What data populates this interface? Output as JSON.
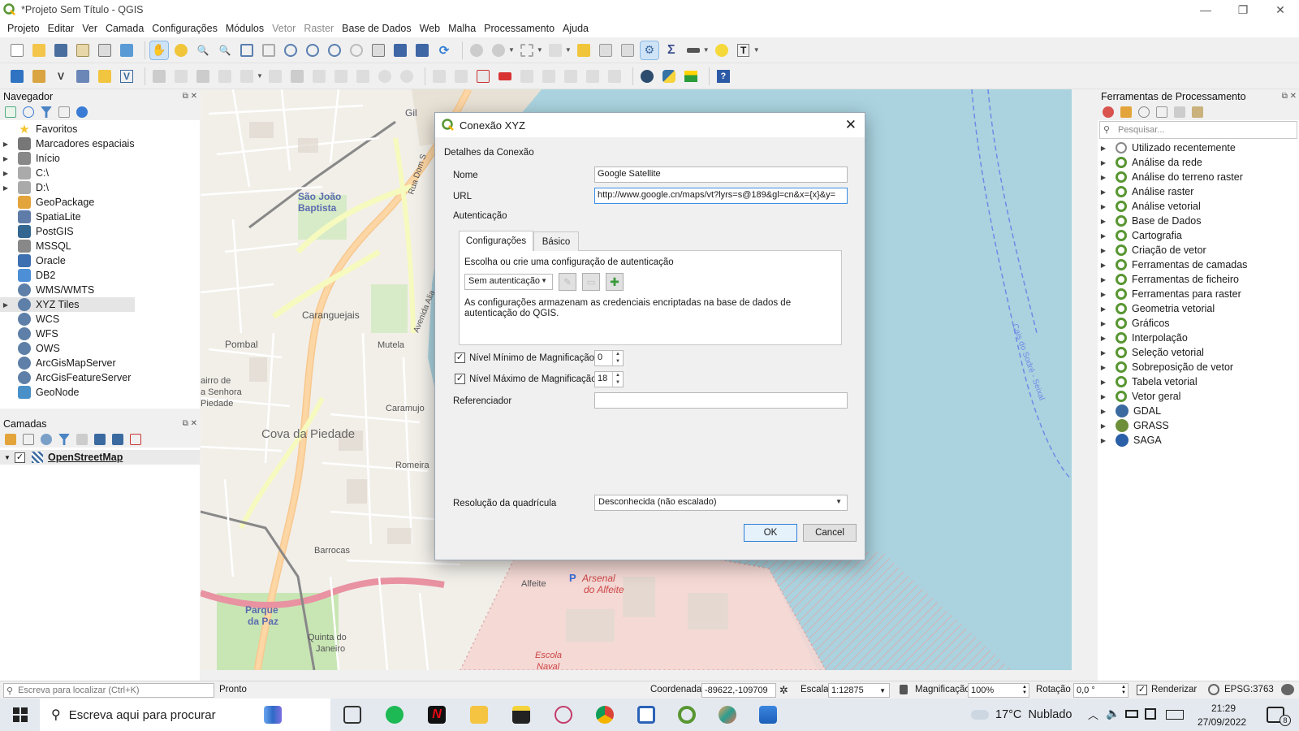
{
  "window": {
    "title": "*Projeto Sem Título - QGIS",
    "minimize_icon": "minimize-icon",
    "maximize_icon": "restore-icon",
    "close_icon": "close-icon"
  },
  "menubar": [
    "Projeto",
    "Editar",
    "Ver",
    "Camada",
    "Configurações",
    "Módulos",
    "Vetor",
    "Raster",
    "Base de Dados",
    "Web",
    "Malha",
    "Processamento",
    "Ajuda"
  ],
  "navigator": {
    "title": "Navegador",
    "items": [
      {
        "label": "Favoritos",
        "icon": "star-icon",
        "color": "#f4c430",
        "expand": false
      },
      {
        "label": "Marcadores espaciais",
        "icon": "bookmark-icon",
        "color": "#777777",
        "expand": true
      },
      {
        "label": "Início",
        "icon": "home-folder-icon",
        "color": "#888888",
        "expand": true
      },
      {
        "label": "C:\\",
        "icon": "folder-icon",
        "color": "#aaaaaa",
        "expand": true
      },
      {
        "label": "D:\\",
        "icon": "folder-icon",
        "color": "#aaaaaa",
        "expand": true
      },
      {
        "label": "GeoPackage",
        "icon": "geopackage-icon",
        "color": "#e3a43b",
        "expand": false
      },
      {
        "label": "SpatiaLite",
        "icon": "spatialite-icon",
        "color": "#5f7ba8",
        "expand": false
      },
      {
        "label": "PostGIS",
        "icon": "postgis-icon",
        "color": "#336791",
        "expand": false
      },
      {
        "label": "MSSQL",
        "icon": "mssql-icon",
        "color": "#888888",
        "expand": false
      },
      {
        "label": "Oracle",
        "icon": "oracle-icon",
        "color": "#3e6fb0",
        "expand": false
      },
      {
        "label": "DB2",
        "icon": "db2-icon",
        "color": "#4c8fd6",
        "expand": false
      },
      {
        "label": "WMS/WMTS",
        "icon": "globe-icon",
        "color": "#5e7fa8",
        "expand": false
      },
      {
        "label": "XYZ Tiles",
        "icon": "globe-icon",
        "color": "#5e7fa8",
        "expand": true
      },
      {
        "label": "WCS",
        "icon": "globe-icon",
        "color": "#5e7fa8",
        "expand": false
      },
      {
        "label": "WFS",
        "icon": "wfs-icon",
        "color": "#5e7fa8",
        "expand": false
      },
      {
        "label": "OWS",
        "icon": "globe-icon",
        "color": "#5e7fa8",
        "expand": false
      },
      {
        "label": "ArcGisMapServer",
        "icon": "arcgis-icon",
        "color": "#5e7fa8",
        "expand": false
      },
      {
        "label": "ArcGisFeatureServer",
        "icon": "arcgis-icon",
        "color": "#5e7fa8",
        "expand": false
      },
      {
        "label": "GeoNode",
        "icon": "geonode-icon",
        "color": "#4a90c8",
        "expand": false
      }
    ]
  },
  "layers": {
    "title": "Camadas",
    "items": [
      {
        "label": "OpenStreetMap",
        "checked": "✓"
      }
    ]
  },
  "processing": {
    "title": "Ferramentas de Processamento",
    "search_placeholder": "Pesquisar...",
    "items": [
      {
        "label": "Utilizado recentemente",
        "icon": "clock-icon",
        "color": "#888888"
      },
      {
        "label": "Análise da rede",
        "icon": "qgis-icon",
        "color": "#589632"
      },
      {
        "label": "Análise do terreno raster",
        "icon": "qgis-icon",
        "color": "#589632"
      },
      {
        "label": "Análise raster",
        "icon": "qgis-icon",
        "color": "#589632"
      },
      {
        "label": "Análise vetorial",
        "icon": "qgis-icon",
        "color": "#589632"
      },
      {
        "label": "Base de Dados",
        "icon": "qgis-icon",
        "color": "#589632"
      },
      {
        "label": "Cartografia",
        "icon": "qgis-icon",
        "color": "#589632"
      },
      {
        "label": "Criação de vetor",
        "icon": "qgis-icon",
        "color": "#589632"
      },
      {
        "label": "Ferramentas de camadas",
        "icon": "qgis-icon",
        "color": "#589632"
      },
      {
        "label": "Ferramentas de ficheiro",
        "icon": "qgis-icon",
        "color": "#589632"
      },
      {
        "label": "Ferramentas para raster",
        "icon": "qgis-icon",
        "color": "#589632"
      },
      {
        "label": "Geometria vetorial",
        "icon": "qgis-icon",
        "color": "#589632"
      },
      {
        "label": "Gráficos",
        "icon": "qgis-icon",
        "color": "#589632"
      },
      {
        "label": "Interpolação",
        "icon": "qgis-icon",
        "color": "#589632"
      },
      {
        "label": "Seleção vetorial",
        "icon": "qgis-icon",
        "color": "#589632"
      },
      {
        "label": "Sobreposição de vetor",
        "icon": "qgis-icon",
        "color": "#589632"
      },
      {
        "label": "Tabela vetorial",
        "icon": "qgis-icon",
        "color": "#589632"
      },
      {
        "label": "Vetor geral",
        "icon": "qgis-icon",
        "color": "#589632"
      },
      {
        "label": "GDAL",
        "icon": "gdal-icon",
        "color": "#3b6aa0"
      },
      {
        "label": "GRASS",
        "icon": "grass-icon",
        "color": "#6d8f3a"
      },
      {
        "label": "SAGA",
        "icon": "saga-icon",
        "color": "#2b5fa8"
      }
    ]
  },
  "map": {
    "labels": [
      "Gil",
      "São João Baptista",
      "Rua Dom S",
      "Caranguejais",
      "Pombal",
      "Avenida Alia",
      "Mutela",
      "airro de a Senhora Piedade",
      "Caramujo",
      "Cova da Piedade",
      "Romeira",
      "Barrocas",
      "Parque da Paz",
      "Quinta do Janeiro",
      "Alfeite",
      "Arsenal do Alfeite",
      "Escola Naval",
      "Cais do Sodré - Seixal"
    ]
  },
  "dialog": {
    "title": "Conexão XYZ",
    "section": "Detalhes da Conexão",
    "name_label": "Nome",
    "name_value": "Google Satellite",
    "url_label": "URL",
    "url_value": "http://www.google.cn/maps/vt?lyrs=s@189&gl=cn&x={x}&y=",
    "auth_label": "Autenticação",
    "tabs": [
      "Configurações",
      "Básico"
    ],
    "auth_hint": "Escolha ou crie uma configuração de autenticação",
    "auth_select": "Sem autenticação",
    "auth_note": "As configurações armazenam as credenciais encriptadas na base de dados de autenticação do QGIS.",
    "min_zoom_label": "Nível Mínimo de Magnificação",
    "min_zoom_value": "0",
    "min_zoom_checked": "✓",
    "max_zoom_label": "Nível Máximo de Magnificação",
    "max_zoom_value": "18",
    "max_zoom_checked": "✓",
    "referer_label": "Referenciador",
    "referer_value": "",
    "resolution_label": "Resolução da quadrícula",
    "resolution_value": "Desconhecida (não escalado)",
    "ok_label": "OK",
    "cancel_label": "Cancel"
  },
  "statusbar": {
    "locator_placeholder": "Escreva para localizar (Ctrl+K)",
    "status": "Pronto",
    "coord_label": "Coordenada",
    "coord_value": "-89622,-109709",
    "scale_label": "Escala",
    "scale_value": "1:12875",
    "magnifier_label": "Magnificação",
    "magnifier_value": "100%",
    "rotation_label": "Rotação",
    "rotation_value": "0,0 °",
    "render_label": "Renderizar",
    "render_checked": "✓",
    "crs": "EPSG:3763"
  },
  "taskbar": {
    "search_placeholder": "Escreva aqui para procurar",
    "weather": "17°C  Nublado",
    "time": "21:29",
    "date": "27/09/2022",
    "notifications": "8"
  },
  "colors": {
    "water": "#aad3df",
    "land": "#f2efe9",
    "qgis_green": "#589632",
    "accent": "#2f7fd6"
  }
}
